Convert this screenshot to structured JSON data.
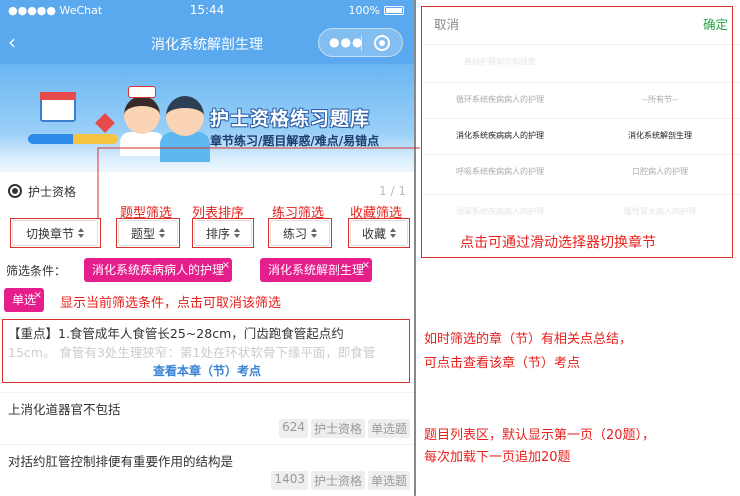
{
  "status_bar": {
    "signal": "●●●●● WeChat",
    "time": "15:44",
    "battery": "100%"
  },
  "nav": {
    "title": "消化系统解剖生理",
    "back_icon": "chevron-left-icon",
    "more_icon": "more-dots-icon",
    "target_icon": "target-icon"
  },
  "banner": {
    "title": "护士资格练习题库",
    "subtitle": "章节练习/题目解惑/难点/易错点"
  },
  "qualification": {
    "label": "护士资格",
    "pager": "1 / 1"
  },
  "filters": {
    "switch_chapter": "切换章节",
    "type": "题型",
    "sort": "排序",
    "practice": "练习",
    "favorite": "收藏"
  },
  "filter_annotations": {
    "type": "题型筛选",
    "sort": "列表排序",
    "practice": "练习筛选",
    "favorite": "收藏筛选"
  },
  "conditions": {
    "label": "筛选条件：",
    "tags": [
      "消化系统疾病病人的护理",
      "消化系统解剖生理",
      "单选"
    ],
    "close": "×",
    "note": "显示当前筛选条件，点击可取消该筛选"
  },
  "keypoint": {
    "line1": "【重点】1.食管成年人食管长25~28cm，门齿跑食管起点约",
    "line2": "15cm。 食管有3处生理狭窄：第1处在环状软骨下缘平面，即食管",
    "link": "查看本章（节）考点",
    "note1": "如时筛选的章（节）有相关点总结，",
    "note2": "可点击查看该章（节）考点"
  },
  "questions": [
    {
      "text": "上消化道器官不包括",
      "count": "624",
      "source": "护士资格",
      "qtype": "单选题"
    },
    {
      "text": "对括约肛管控制排便有重要作用的结构是",
      "count": "1403",
      "source": "护士资格",
      "qtype": "单选题"
    }
  ],
  "list_note": {
    "line1": "题目列表区，默认显示第一页（20题），",
    "line2": "每次加载下一页追加20题"
  },
  "picker": {
    "cancel": "取消",
    "confirm": "确定",
    "rows": [
      {
        "left": "基础护理知识和技能",
        "right": ""
      },
      {
        "left": "循环系统疾病病人的护理",
        "right": "--所有节--"
      },
      {
        "left": "消化系统疾病病人的护理",
        "right": "消化系统解剖生理"
      },
      {
        "left": "呼吸系统疾病病人的护理",
        "right": "口腔病人的护理"
      },
      {
        "left": "泌尿系统疾病病人的护理",
        "right": "慢性胃炎病人的护理"
      }
    ],
    "note": "点击可通过滑动选择器切换章节"
  },
  "colors": {
    "nav_blue": "#5aa8ed",
    "tag_pink": "#e61e8c",
    "annotation_red": "#e8201c",
    "confirm_green": "#2aa44a"
  }
}
